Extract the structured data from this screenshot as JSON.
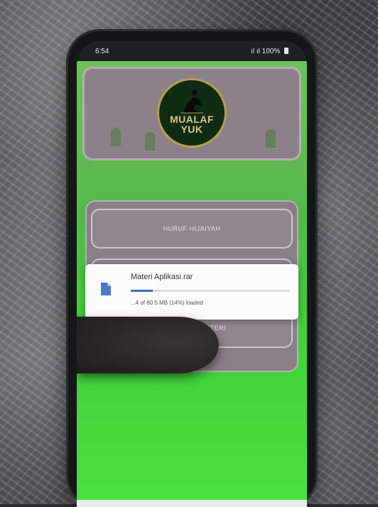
{
  "status_bar": {
    "time": "6:54",
    "right_indicators": "⛬ ıl ⁂ ıl 100%",
    "battery_percent": "100%"
  },
  "app": {
    "logo_text_line1": "MUALAF",
    "logo_text_line2": "YUK"
  },
  "menu": {
    "items": [
      {
        "label": "HURUF HIJAIYAH"
      },
      {
        "label": ""
      },
      {
        "label": "DOWNLOAD MATERI"
      }
    ]
  },
  "download": {
    "file_name": "Materi Aplikasi.rar",
    "progress_text": "...4 of 80.5 MB (14%) loaded",
    "progress_fraction": 0.14,
    "progress_color": "#3d6fc4"
  },
  "colors": {
    "app_green": "#49e23e",
    "panel": "#8b8088",
    "logo_bg": "#0f2b12"
  }
}
